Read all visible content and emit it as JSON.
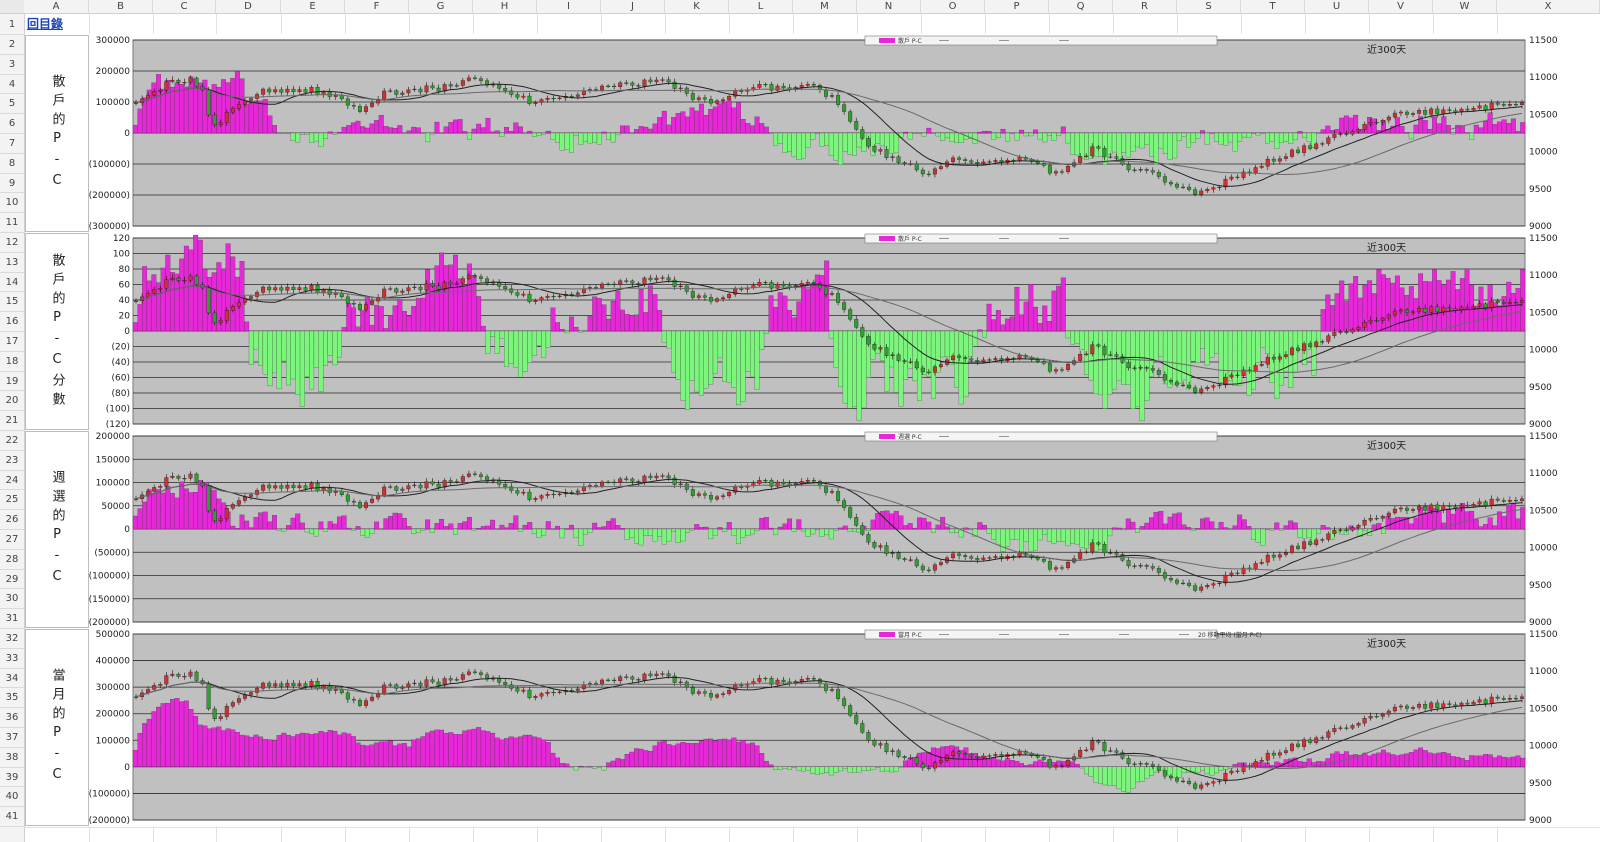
{
  "sheet": {
    "toc_link": "回目錄",
    "columns": [
      "A",
      "B",
      "C",
      "D",
      "E",
      "F",
      "G",
      "H",
      "I",
      "J",
      "K",
      "L",
      "M",
      "N",
      "O",
      "P",
      "Q",
      "R",
      "S",
      "T",
      "U",
      "V",
      "W",
      "X"
    ],
    "rows": [
      "1",
      "2",
      "3",
      "4",
      "5",
      "6",
      "7",
      "8",
      "9",
      "10",
      "11",
      "12",
      "13",
      "14",
      "15",
      "16",
      "17",
      "18",
      "19",
      "20",
      "21",
      "22",
      "23",
      "24",
      "25",
      "26",
      "27",
      "28",
      "29",
      "30",
      "31",
      "32",
      "33",
      "34",
      "35",
      "36",
      "37",
      "38",
      "39",
      "40",
      "41"
    ],
    "row_labels": [
      "散戶的P-C",
      "散戶的P-C分數",
      "週選的P-C",
      "當月的P-C"
    ]
  },
  "colors": {
    "plot_bg": "#c0c0c0",
    "positive_bar": "#e628d8",
    "negative_bar": "#7cf57c",
    "candle_up": "#d23030",
    "candle_down": "#2fa02f",
    "line": "#222222",
    "line_gray": "#6a6a6a"
  },
  "chart_data": [
    {
      "type": "bar",
      "title": "",
      "annotation": "近300天",
      "legend": {
        "position": "top",
        "entries": [
          "散戶 P-C",
          "",
          "",
          ""
        ]
      },
      "y_left": {
        "ticks": [
          "300000",
          "200000",
          "100000",
          "0",
          "(100000)",
          "(200000)",
          "(300000)"
        ],
        "range": [
          -300000,
          300000
        ]
      },
      "y_right": {
        "ticks": [
          "11500",
          "11000",
          "10500",
          "10000",
          "9500",
          "9000"
        ],
        "range": [
          9000,
          11500
        ]
      },
      "series": [
        {
          "values_hint": "daily bars, positive (magenta) / negative (green), overlaid with index candlesticks and moving averages"
        }
      ]
    },
    {
      "type": "bar",
      "title": "",
      "annotation": "近300天",
      "legend": {
        "position": "top",
        "entries": [
          "散戶 P-C",
          "",
          "",
          ""
        ]
      },
      "y_left": {
        "ticks": [
          "120",
          "100",
          "80",
          "60",
          "40",
          "20",
          "0",
          "(20)",
          "(40)",
          "(60)",
          "(80)",
          "(100)",
          "(120)"
        ],
        "range": [
          -120,
          120
        ]
      },
      "y_right": {
        "ticks": [
          "11500",
          "11000",
          "10500",
          "10000",
          "9500",
          "9000"
        ],
        "range": [
          9000,
          11500
        ]
      }
    },
    {
      "type": "bar",
      "title": "",
      "annotation": "近300天",
      "legend": {
        "position": "top",
        "entries": [
          "週選 P-C",
          "",
          ""
        ]
      },
      "y_left": {
        "ticks": [
          "200000",
          "150000",
          "100000",
          "50000",
          "0",
          "(50000)",
          "(100000)",
          "(150000)",
          "(200000)"
        ],
        "range": [
          -200000,
          200000
        ]
      },
      "y_right": {
        "ticks": [
          "11500",
          "11000",
          "10500",
          "10000",
          "9500",
          "9000"
        ],
        "range": [
          9000,
          11500
        ]
      }
    },
    {
      "type": "bar",
      "title": "",
      "annotation": "近300天",
      "legend": {
        "position": "top",
        "entries": [
          "當月 P-C",
          "",
          "",
          "",
          "",
          "20 移動平均 (當月 P-C)"
        ]
      },
      "y_left": {
        "ticks": [
          "500000",
          "400000",
          "300000",
          "200000",
          "100000",
          "0",
          "(100000)",
          "(200000)"
        ],
        "range": [
          -200000,
          500000
        ]
      },
      "y_right": {
        "ticks": [
          "11500",
          "11000",
          "10500",
          "10000",
          "9500",
          "9000"
        ],
        "range": [
          9000,
          11500
        ]
      }
    }
  ]
}
